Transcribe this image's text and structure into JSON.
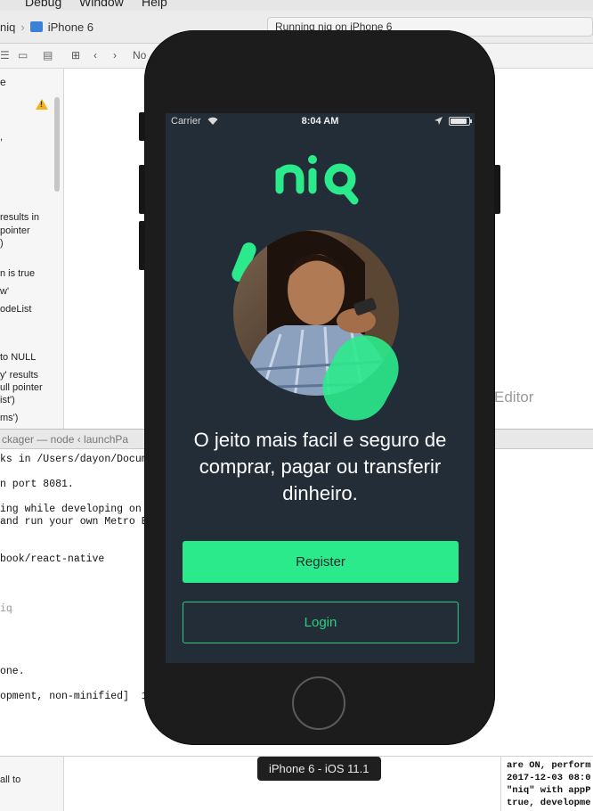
{
  "menubar": {
    "items": [
      "Debug",
      "Window",
      "Help"
    ]
  },
  "toolbar": {
    "scheme": "niq",
    "destination": "iPhone 6",
    "activity": "Running niq on iPhone 6"
  },
  "navigator": {
    "header": "e",
    "issue_lines": [
      ",",
      "results in",
      "pointer",
      ")",
      "n is true",
      "w'",
      "odeList",
      "to NULL",
      "y' results",
      "ull pointer",
      "ist')",
      "ms')"
    ]
  },
  "jumpbar": {
    "label": "No"
  },
  "editor": {
    "placeholder": "Editor"
  },
  "terminal": {
    "title": "ckager — node ‹ launchPa",
    "lines": [
      "ks in /Users/dayon/Docum",
      "n port 8081.",
      "ing while developing on",
      "and run your own Metro B",
      "book/react-native",
      "iq",
      "one.",
      "opment, non-minified]  1"
    ]
  },
  "bottom_left": {
    "text": "all to"
  },
  "console": {
    "lines": [
      "are ON, perform",
      "2017-12-03 08:0",
      "\"niq\" with appP",
      "true, developme"
    ]
  },
  "simulator": {
    "label": "iPhone 6 - iOS 11.1"
  },
  "app": {
    "status": {
      "carrier": "Carrier",
      "time": "8:04 AM"
    },
    "logo_text": "niq",
    "tagline": "O jeito mais facil e seguro de comprar, pagar ou transferir dinheiro.",
    "register_label": "Register",
    "login_label": "Login",
    "colors": {
      "accent": "#2bea8c",
      "background": "#232d38",
      "bezel": "#1c1c1c"
    }
  }
}
